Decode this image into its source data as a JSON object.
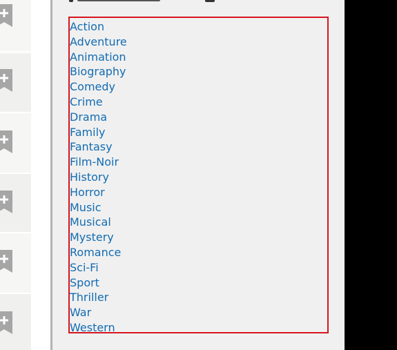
{
  "genres": [
    "Action",
    "Adventure",
    "Animation",
    "Biography",
    "Comedy",
    "Crime",
    "Drama",
    "Family",
    "Fantasy",
    "Film-Noir",
    "History",
    "Horror",
    "Music",
    "Musical",
    "Mystery",
    "Romance",
    "Sci-Fi",
    "Sport",
    "Thriller",
    "War",
    "Western"
  ],
  "colors": {
    "link": "#136cb2",
    "highlight_border": "#d6141e",
    "panel_bg": "#f0f0f0",
    "ribbon": "#a6a6a6"
  },
  "icons": {
    "watchlist": "add-to-watchlist-ribbon-icon"
  }
}
